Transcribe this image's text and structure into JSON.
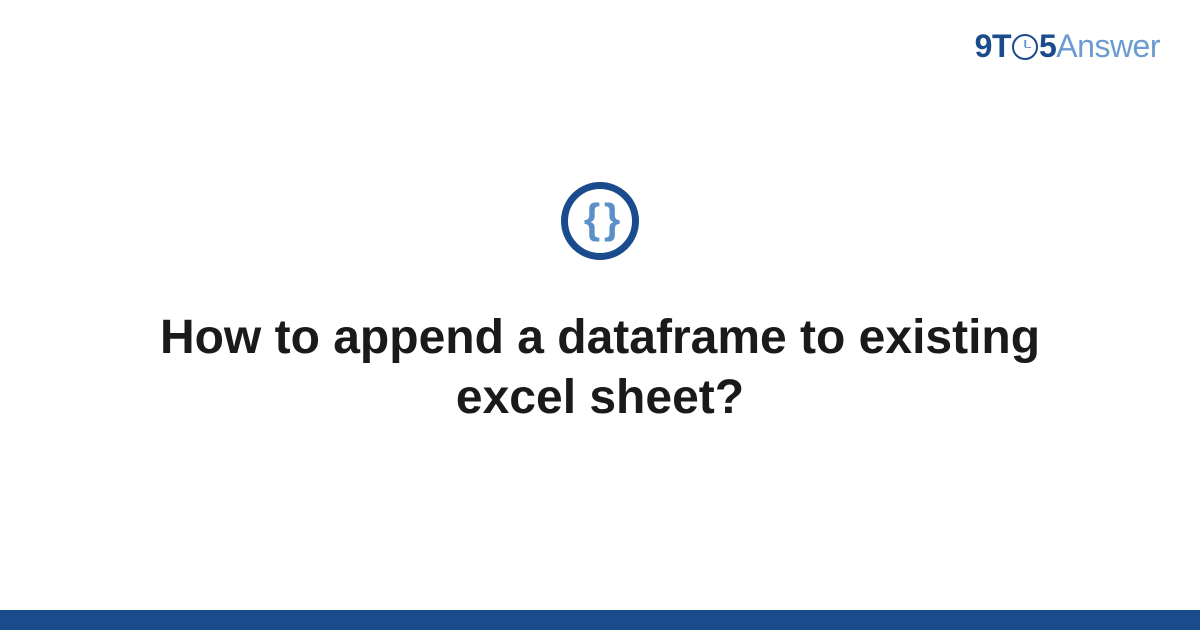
{
  "logo": {
    "part1": "9T",
    "part2": "5",
    "part3": "Answer"
  },
  "icon": {
    "glyph": "{ }"
  },
  "title": "How to append a dataframe to existing excel sheet?",
  "colors": {
    "primary": "#1a4b8c",
    "secondary": "#6b9bd1",
    "text": "#1a1a1a"
  }
}
